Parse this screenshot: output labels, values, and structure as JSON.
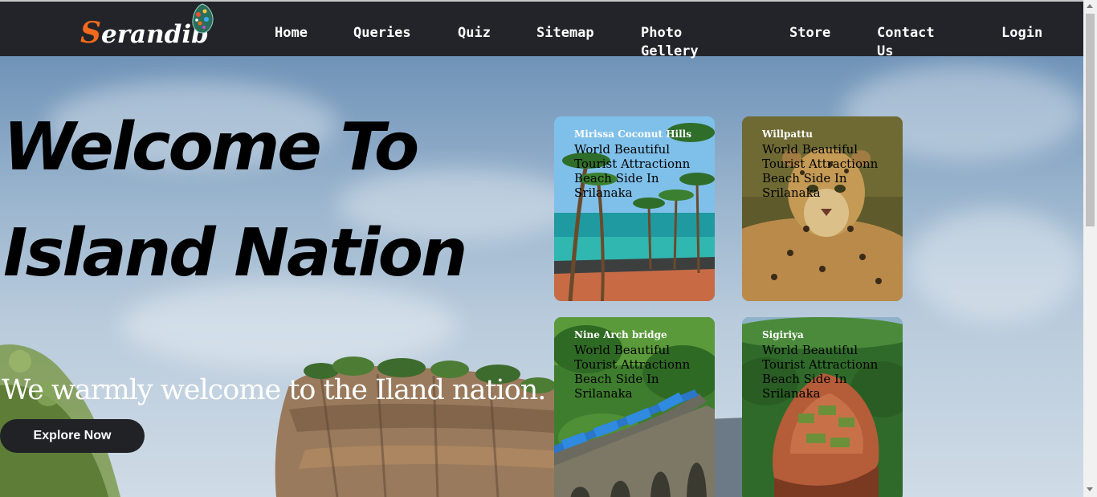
{
  "nav": {
    "logo_first_letter": "S",
    "logo_rest": "erandib",
    "items": [
      {
        "label": "Home"
      },
      {
        "label": "Queries"
      },
      {
        "label": "Quiz"
      },
      {
        "label": "Sitemap"
      },
      {
        "label": "Photo Gellery"
      },
      {
        "label": "Store"
      },
      {
        "label": "Contact Us"
      },
      {
        "label": "Login"
      }
    ]
  },
  "hero": {
    "headline": "Welcome To Island Nation",
    "subline": "We warmly welcome to the Iland nation.",
    "cta_label": "Explore Now"
  },
  "cards": [
    {
      "title": "Mirissa Coconut Hills",
      "description": "World Beautiful Tourist Attractionn Beach Side In Srilanaka"
    },
    {
      "title": "Willpattu",
      "description": "World Beautiful Tourist Attractionn Beach Side In Srilanaka"
    },
    {
      "title": "Nine Arch bridge",
      "description": "World Beautiful Tourist Attractionn Beach Side In Srilanaka"
    },
    {
      "title": "Sigiriya",
      "description": "World Beautiful Tourist Attractionn Beach Side In Srilanaka"
    }
  ],
  "colors": {
    "nav_bg": "#232429",
    "logo_accent": "#f26a1b",
    "button_bg": "#202226"
  }
}
